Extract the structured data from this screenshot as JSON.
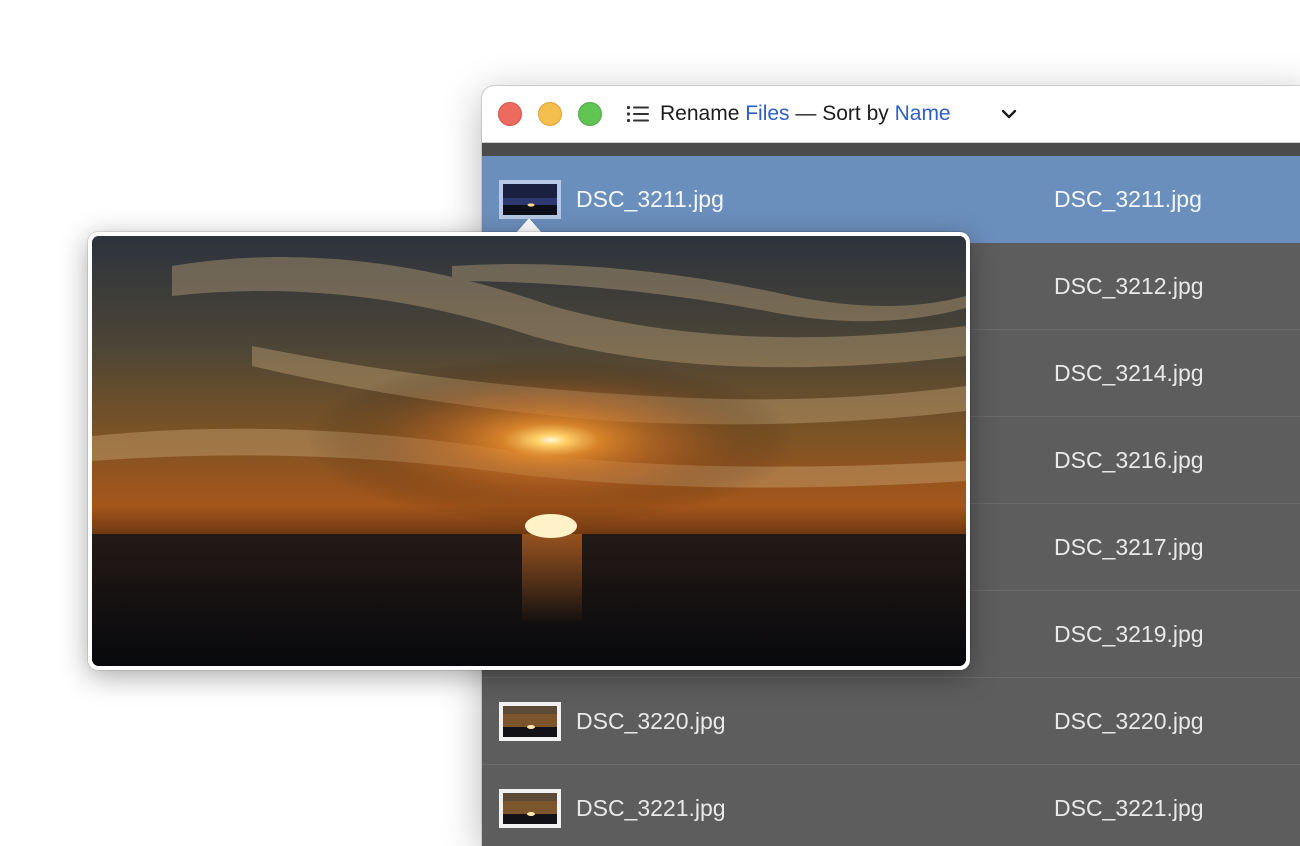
{
  "window": {
    "title": {
      "part1": "Rename ",
      "part2": "Files",
      "part3": " — Sort by ",
      "part4": "Name"
    },
    "icons": {
      "list": "list-icon",
      "dropdown": "chevron-down-icon"
    },
    "traffic_lights": [
      "close",
      "minimize",
      "zoom"
    ]
  },
  "rows": [
    {
      "original": "DSC_3211.jpg",
      "renamed": "DSC_3211.jpg",
      "selected": true
    },
    {
      "original": "",
      "renamed": "DSC_3212.jpg",
      "selected": false
    },
    {
      "original": "",
      "renamed": "DSC_3214.jpg",
      "selected": false
    },
    {
      "original": "",
      "renamed": "DSC_3216.jpg",
      "selected": false
    },
    {
      "original": "",
      "renamed": "DSC_3217.jpg",
      "selected": false
    },
    {
      "original": "",
      "renamed": "DSC_3219.jpg",
      "selected": false
    },
    {
      "original": "DSC_3220.jpg",
      "renamed": "DSC_3220.jpg",
      "selected": false
    },
    {
      "original": "DSC_3221.jpg",
      "renamed": "DSC_3221.jpg",
      "selected": false
    }
  ],
  "colors": {
    "accent": "#2f5fc4",
    "selection": "#6b8fbd",
    "list_background": "#5d5d5d"
  }
}
